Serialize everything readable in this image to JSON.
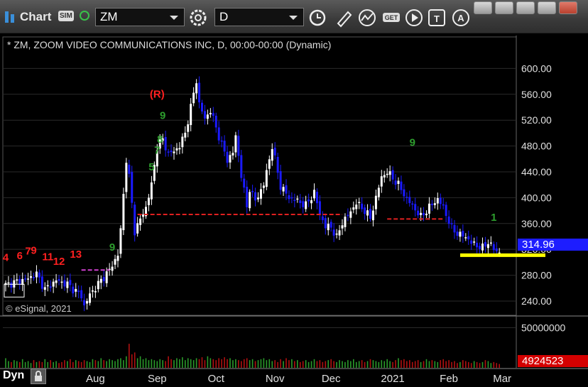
{
  "toolbar": {
    "app_title": "Chart",
    "sim_badge": "SIM",
    "symbol": "ZM",
    "interval": "D"
  },
  "chart_title": "* ZM, ZOOM VIDEO COMMUNICATIONS INC, D, 00:00-00:00 (Dynamic)",
  "copyright": "© eSignal, 2021",
  "bottom_label": "Dyn",
  "colors": {
    "up": "#ffffff",
    "down": "#1a1aff",
    "annotation_red": "#ff2020",
    "annotation_green": "#2e9e2e",
    "support_line": "#e02020",
    "yellow": "#ffff00"
  },
  "chart_data": {
    "type": "candlestick",
    "symbol": "ZM",
    "price_axis": {
      "ticks": [
        "600.00",
        "560.00",
        "520.00",
        "480.00",
        "440.00",
        "400.00",
        "360.00",
        "320.00",
        "280.00",
        "240.00"
      ],
      "range": [
        218,
        640
      ]
    },
    "volume_axis": {
      "ticks": [
        "50000000"
      ],
      "range": [
        0,
        62000000
      ]
    },
    "last_price": "314.96",
    "last_volume": "4924523",
    "months": [
      "Aug",
      "Sep",
      "Oct",
      "Nov",
      "Dec",
      "2021",
      "Feb",
      "Mar"
    ],
    "month_start_index": [
      32,
      54,
      75,
      96,
      116,
      138,
      158,
      177
    ],
    "anchors": [
      [
        0,
        265
      ],
      [
        8,
        275
      ],
      [
        11,
        282
      ],
      [
        14,
        258
      ],
      [
        18,
        272
      ],
      [
        22,
        266
      ],
      [
        27,
        248
      ],
      [
        28,
        232
      ],
      [
        30,
        250
      ],
      [
        34,
        272
      ],
      [
        37,
        288
      ],
      [
        40,
        312
      ],
      [
        41,
        350
      ],
      [
        43,
        460
      ],
      [
        44,
        432
      ],
      [
        46,
        348
      ],
      [
        50,
        385
      ],
      [
        52,
        420
      ],
      [
        54,
        480
      ],
      [
        56,
        490
      ],
      [
        58,
        468
      ],
      [
        60,
        472
      ],
      [
        62,
        480
      ],
      [
        64,
        500
      ],
      [
        66,
        540
      ],
      [
        68,
        582
      ],
      [
        69,
        545
      ],
      [
        71,
        522
      ],
      [
        73,
        535
      ],
      [
        76,
        495
      ],
      [
        79,
        458
      ],
      [
        81,
        470
      ],
      [
        82,
        495
      ],
      [
        84,
        435
      ],
      [
        86,
        385
      ],
      [
        87,
        415
      ],
      [
        89,
        395
      ],
      [
        92,
        420
      ],
      [
        94,
        460
      ],
      [
        95,
        480
      ],
      [
        98,
        418
      ],
      [
        101,
        400
      ],
      [
        104,
        395
      ],
      [
        107,
        388
      ],
      [
        110,
        408
      ],
      [
        112,
        375
      ],
      [
        114,
        355
      ],
      [
        116,
        355
      ],
      [
        118,
        338
      ],
      [
        120,
        362
      ],
      [
        122,
        372
      ],
      [
        125,
        392
      ],
      [
        128,
        380
      ],
      [
        130,
        368
      ],
      [
        132,
        400
      ],
      [
        134,
        432
      ],
      [
        136,
        440
      ],
      [
        138,
        430
      ],
      [
        140,
        420
      ],
      [
        143,
        398
      ],
      [
        146,
        382
      ],
      [
        148,
        370
      ],
      [
        151,
        385
      ],
      [
        154,
        398
      ],
      [
        156,
        385
      ],
      [
        159,
        352
      ],
      [
        162,
        342
      ],
      [
        164,
        340
      ],
      [
        166,
        330
      ],
      [
        170,
        322
      ],
      [
        172,
        332
      ],
      [
        174,
        320
      ],
      [
        176,
        315
      ]
    ],
    "volumes": [
      10,
      7,
      6,
      8,
      7,
      6,
      9,
      6,
      7,
      5,
      8,
      6,
      7,
      6,
      9,
      6,
      8,
      6,
      7,
      5,
      6,
      8,
      7,
      9,
      6,
      8,
      7,
      6,
      8,
      7,
      6,
      9,
      8,
      7,
      10,
      8,
      7,
      9,
      8,
      7,
      9,
      10,
      8,
      12,
      25,
      14,
      16,
      10,
      12,
      9,
      10,
      8,
      9,
      8,
      7,
      9,
      8,
      7,
      12,
      9,
      8,
      10,
      9,
      11,
      8,
      10,
      9,
      8,
      10,
      9,
      11,
      8,
      12,
      10,
      9,
      8,
      10,
      9,
      11,
      9,
      10,
      8,
      9,
      8,
      7,
      9,
      10,
      8,
      9,
      7,
      8,
      9,
      10,
      8,
      9,
      7,
      8,
      6,
      9,
      7,
      10,
      8,
      9,
      7,
      8,
      6,
      7,
      8,
      6,
      7,
      9,
      7,
      8,
      6,
      7,
      8,
      9,
      7,
      6,
      8,
      7,
      6,
      8,
      7,
      9,
      6,
      7,
      8,
      6,
      7,
      9,
      8,
      7,
      6,
      8,
      7,
      9,
      7,
      6,
      8,
      10,
      8,
      9,
      7,
      8,
      6,
      7,
      8,
      6,
      7,
      9,
      7,
      8,
      7,
      6,
      8,
      9,
      7,
      8,
      6,
      7,
      5,
      6,
      8,
      7,
      6,
      5,
      7,
      6,
      5,
      6,
      8,
      7,
      5,
      6,
      5,
      4
    ]
  },
  "annotations": [
    {
      "text": "(R)",
      "price": 555,
      "index": 54,
      "color": "red"
    },
    {
      "text": "9",
      "price": 522,
      "index": 56,
      "color": "green"
    },
    {
      "text": "8",
      "price": 485,
      "index": 55,
      "color": "green"
    },
    {
      "text": "7",
      "price": 468,
      "index": 54,
      "color": "green"
    },
    {
      "text": "5",
      "price": 442,
      "index": 52,
      "color": "green"
    },
    {
      "text": "4",
      "price": 302,
      "index": 0,
      "color": "red"
    },
    {
      "text": "6",
      "price": 305,
      "index": 5,
      "color": "red"
    },
    {
      "text": "7",
      "price": 312,
      "index": 8,
      "color": "red"
    },
    {
      "text": "9",
      "price": 313,
      "index": 10,
      "color": "red"
    },
    {
      "text": "11",
      "price": 303,
      "index": 15,
      "color": "red"
    },
    {
      "text": "12",
      "price": 296,
      "index": 19,
      "color": "red"
    },
    {
      "text": "13",
      "price": 307,
      "index": 25,
      "color": "red"
    },
    {
      "text": "9",
      "price": 318,
      "index": 38,
      "color": "green"
    },
    {
      "text": "9",
      "price": 480,
      "index": 145,
      "color": "green"
    },
    {
      "text": "1",
      "price": 364,
      "index": 174,
      "color": "green"
    }
  ],
  "support_lines": [
    {
      "price": 374,
      "from_index": 47,
      "to_index": 120,
      "color": "red"
    },
    {
      "price": 367,
      "from_index": 136,
      "to_index": 156,
      "color": "red"
    },
    {
      "price": 288,
      "from_index": 27,
      "to_index": 37,
      "color": "magenta"
    }
  ]
}
